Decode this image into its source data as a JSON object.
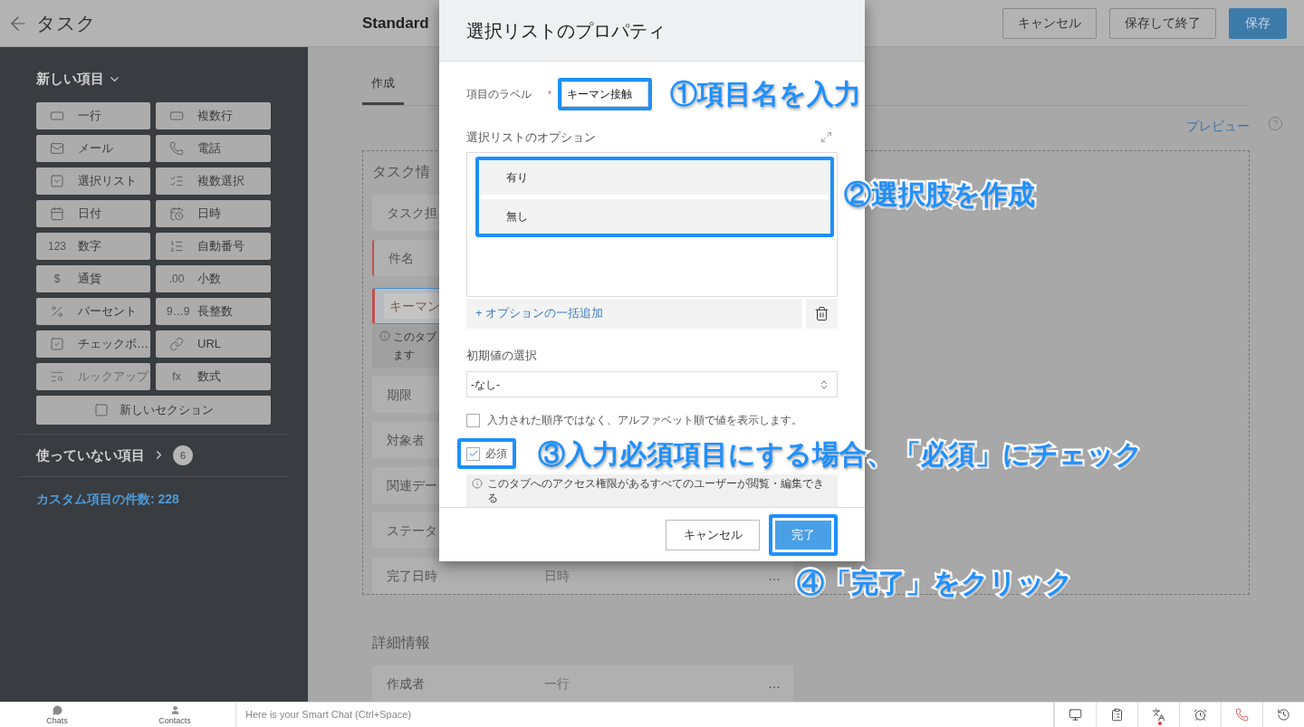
{
  "header": {
    "title": "タスク",
    "layout_name": "Standard",
    "buttons": [
      {
        "label": "キャンセル",
        "kind": "outline"
      },
      {
        "label": "保存して終了",
        "kind": "outline"
      },
      {
        "label": "保存",
        "kind": "primary"
      }
    ]
  },
  "sidebar": {
    "new_fields": {
      "title": "新しい項目",
      "expanded": true
    },
    "field_types": [
      {
        "label": "一行",
        "kind": "single-line",
        "disabled": false
      },
      {
        "label": "複数行",
        "kind": "multi-line",
        "disabled": false
      },
      {
        "label": "メール",
        "kind": "email",
        "disabled": false
      },
      {
        "label": "電話",
        "kind": "phone",
        "disabled": false
      },
      {
        "label": "選択リスト",
        "kind": "picklist",
        "disabled": false
      },
      {
        "label": "複数選択",
        "kind": "multi-select",
        "disabled": false
      },
      {
        "label": "日付",
        "kind": "date",
        "disabled": false
      },
      {
        "label": "日時",
        "kind": "datetime",
        "disabled": false
      },
      {
        "label": "数字",
        "kind": "glyph",
        "glyph": "123",
        "disabled": false
      },
      {
        "label": "自動番号",
        "kind": "auto-number",
        "disabled": false
      },
      {
        "label": "通貨",
        "kind": "glyph",
        "glyph": "$",
        "disabled": false
      },
      {
        "label": "小数",
        "kind": "glyph",
        "glyph": ".00",
        "disabled": false
      },
      {
        "label": "パーセント",
        "kind": "percent",
        "disabled": false
      },
      {
        "label": "長整数",
        "kind": "glyph",
        "glyph": "9…9",
        "disabled": false
      },
      {
        "label": "チェックボ…",
        "kind": "checkbox",
        "disabled": false
      },
      {
        "label": "URL",
        "kind": "url",
        "disabled": false
      },
      {
        "label": "ルックアップ",
        "kind": "lookup",
        "disabled": true
      },
      {
        "label": "数式",
        "kind": "glyph",
        "glyph": "fx",
        "disabled": false
      }
    ],
    "new_section": "新しいセクション",
    "unused": {
      "label": "使っていない項目",
      "count": "6",
      "expanded": false
    },
    "custom_count": "カスタム項目の件数: 228"
  },
  "main": {
    "tabs": [
      {
        "label": "作成",
        "selected": true
      }
    ],
    "preview": "プレビュー",
    "sections": [
      {
        "title": "タスク情",
        "selected": true,
        "rows": [
          {
            "kind": "field",
            "label": "タスク担"
          },
          {
            "kind": "required",
            "label": "件名"
          },
          {
            "kind": "new",
            "label": "キーマン"
          },
          {
            "kind": "note",
            "lines": [
              "このタブ",
              "ます"
            ]
          },
          {
            "kind": "field",
            "label": "期限"
          },
          {
            "kind": "field",
            "label": "対象者"
          },
          {
            "kind": "field",
            "label": "関連デー"
          },
          {
            "kind": "field",
            "label": "ステータ"
          },
          {
            "kind": "field",
            "label": "完了日時",
            "value": "日時",
            "more": "…"
          }
        ]
      },
      {
        "title": "詳細情報",
        "selected": false,
        "rows": [
          {
            "kind": "field",
            "label": "作成者",
            "value": "一行",
            "more": "…"
          }
        ]
      }
    ]
  },
  "modal": {
    "title": "選択リストのプロパティ",
    "label_field": {
      "label": "項目のラベル",
      "required_mark": "*",
      "value": "キーマン接触"
    },
    "options_title": "選択リストのオプション",
    "options": [
      "有り",
      "無し"
    ],
    "bulk_add": "+ オプションの一括追加",
    "default_label": "初期値の選択",
    "default_value": "-なし-",
    "sort_alpha": {
      "label": "入力された順序ではなく、アルファベット順で値を表示します。",
      "checked": false
    },
    "required": {
      "label": "必須",
      "checked": true
    },
    "note": "このタブへのアクセス権限があるすべてのユーザーが閲覧・編集できる",
    "buttons": [
      {
        "label": "キャンセル",
        "kind": "outline"
      },
      {
        "label": "完了",
        "kind": "primary"
      }
    ]
  },
  "annotations": [
    "①項目名を入力",
    "②選択肢を作成",
    "③入力必須項目にする場合、「必須」にチェック",
    "④「完了」をクリック"
  ],
  "bottom_bar": {
    "tabs": [
      {
        "label": "Chats",
        "kind": "chats"
      },
      {
        "label": "Contacts",
        "kind": "contacts"
      }
    ],
    "chat_placeholder": "Here is your Smart Chat (Ctrl+Space)",
    "tools": [
      {
        "kind": "screen"
      },
      {
        "kind": "clipboard"
      },
      {
        "kind": "translate",
        "notify": true
      },
      {
        "kind": "alarm"
      },
      {
        "kind": "call"
      },
      {
        "kind": "history"
      }
    ]
  }
}
